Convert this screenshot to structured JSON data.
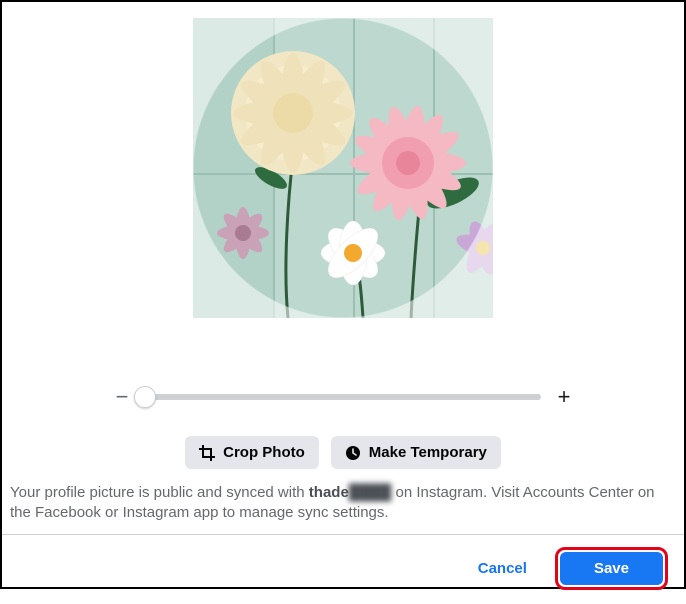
{
  "preview": {
    "image_alt": "flowers-on-mint-background"
  },
  "zoom": {
    "minus_glyph": "−",
    "plus_glyph": "+",
    "value_percent": 0
  },
  "buttons": {
    "crop_label": "Crop Photo",
    "temp_label": "Make Temporary",
    "cancel_label": "Cancel",
    "save_label": "Save"
  },
  "description": {
    "prefix": "Your profile picture is public and synced with ",
    "username_visible": "thade",
    "username_hidden": "████",
    "suffix": " on Instagram. Visit Accounts Center on the Facebook or Instagram app to manage sync settings."
  }
}
